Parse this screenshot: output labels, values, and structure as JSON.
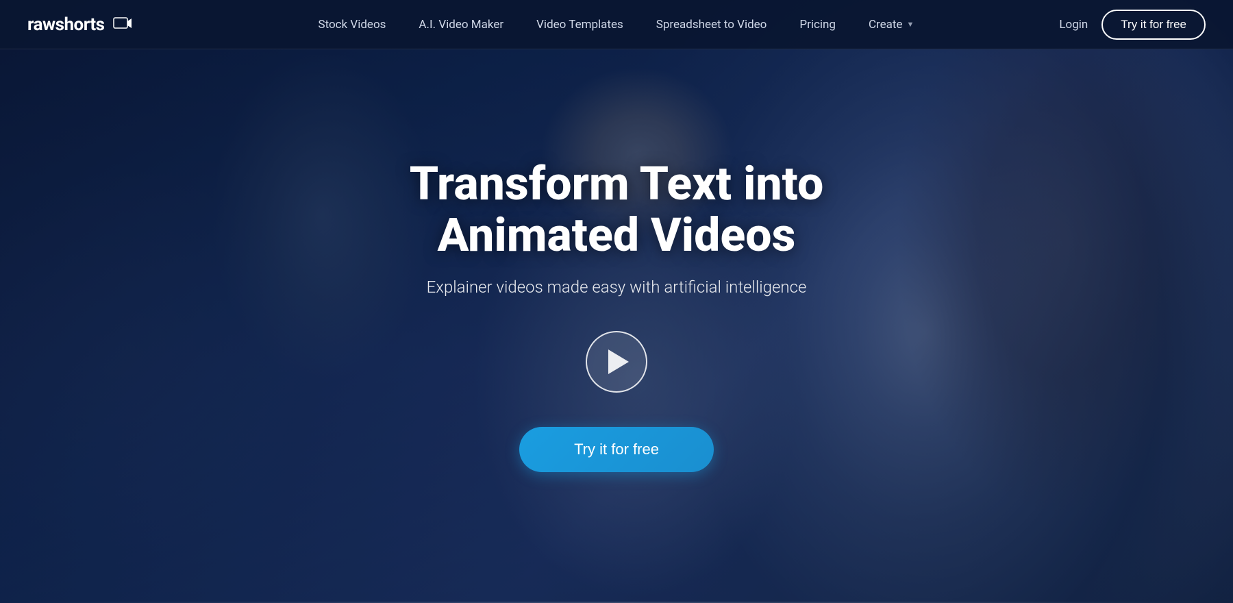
{
  "logo": {
    "text_raw": "raw",
    "text_bold": "shorts",
    "icon_label": "video-play-icon"
  },
  "navbar": {
    "links": [
      {
        "label": "Stock Videos",
        "id": "stock-videos",
        "has_chevron": false
      },
      {
        "label": "A.I. Video Maker",
        "id": "ai-video-maker",
        "has_chevron": false
      },
      {
        "label": "Video Templates",
        "id": "video-templates",
        "has_chevron": false
      },
      {
        "label": "Spreadsheet to Video",
        "id": "spreadsheet-to-video",
        "has_chevron": false
      },
      {
        "label": "Pricing",
        "id": "pricing",
        "has_chevron": false
      },
      {
        "label": "Create",
        "id": "create",
        "has_chevron": true
      }
    ],
    "login_label": "Login",
    "try_free_label": "Try it for free"
  },
  "hero": {
    "title": "Transform Text into Animated Videos",
    "subtitle": "Explainer videos made easy with artificial intelligence",
    "play_button_label": "Play video",
    "cta_label": "Try it for free"
  }
}
